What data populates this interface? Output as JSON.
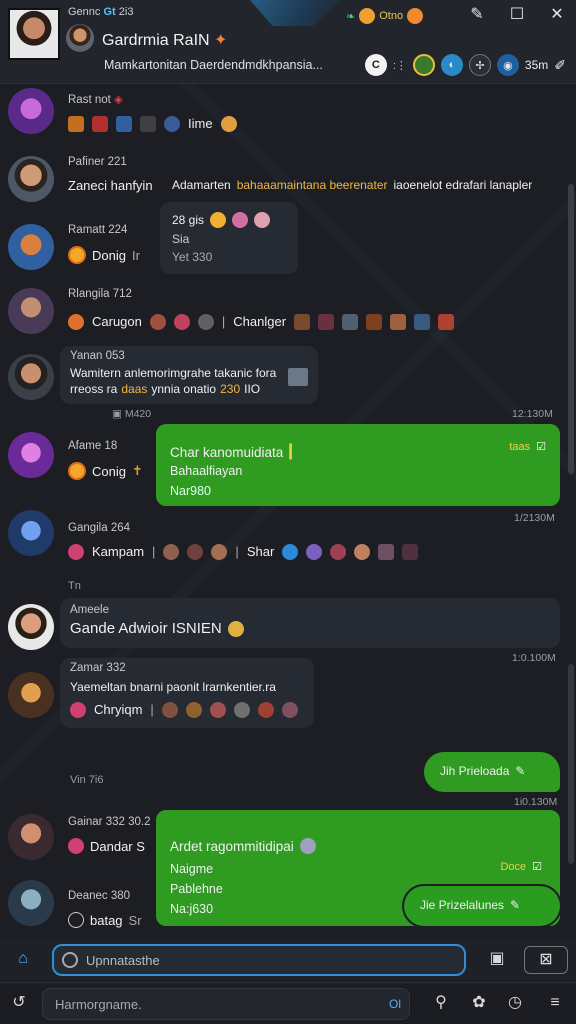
{
  "header": {
    "top_text": "Gennc",
    "top_accent": "Gt",
    "top_extra": "2i3",
    "title": "Gardrmia RaIN",
    "subtitle": "Mamkartonitan Daerdendmdkhpansia...",
    "meta_label": "Otno",
    "count_label": "35m",
    "sub_badge": "C"
  },
  "messages": [
    {
      "name": "Rast not",
      "chips": [
        "Iime"
      ]
    },
    {
      "name": "Pafiner 221",
      "line1": "Zaneci hanfyin",
      "line2": "Adamarten",
      "line2_hl": "bahaaamaintana beerenater",
      "line2_rest": "iaoenelot edrafari lanapler"
    },
    {
      "name": "Ramatt 224",
      "line1": "Donig",
      "suffix": "Ir",
      "bubble_line1": "28 gis",
      "bubble_line2": "Sia",
      "bubble_line3": "Yet 330"
    },
    {
      "name": "Rlangila 712",
      "line1": "Carugon",
      "line2": "Chanlger"
    },
    {
      "name": "Yanan 053",
      "line1": "Wamitern anlemorimgrahe takanic fora",
      "line2a": "rreoss ra",
      "line2_hl": "daas",
      "line2b": "ynnia onatio",
      "line2_hl2": "230",
      "line2c": "IIO",
      "time_left": "M420",
      "time_right": "12:130M"
    },
    {
      "name": "Afame 18",
      "line1": "Conig",
      "green_title": "Char kanomuidiata",
      "green_line2": "Bahaalfiayan",
      "green_line3": "Nar980",
      "green_tag": "taas",
      "time_right": "1/2130M"
    },
    {
      "name": "Gangila 264",
      "line1": "Kampam",
      "line2": "Shar"
    },
    {
      "name": "Ameele",
      "day": "Tn",
      "line1": "Gande Adwioir ISNIEN"
    },
    {
      "name": "Zamar 332",
      "line1": "Yaemeltan bnarni paonit lrarnkentier.ra",
      "line2": "Chryiqm",
      "time_right": "1:0.100M"
    },
    {
      "name": "Vin 7i6",
      "outgoing1": "Jih Prieloada",
      "time_right": "1i0.130M"
    },
    {
      "name": "Gainar 332 30.2",
      "line1": "Dandar S",
      "green_title": "Ardet ragommitidipai",
      "green_line2": "Naigme",
      "green_line3": "Pablehne",
      "green_line4": "Na:j630",
      "green_tag": "Doce"
    },
    {
      "name": "Deanec 380",
      "line1": "batag",
      "suffix": "Sr",
      "outgoing2": "Jie Prizelalunes"
    }
  ],
  "composer": {
    "placeholder": "Upnnatasthe"
  },
  "bottom": {
    "placeholder": "Harmorgname.",
    "hint": "Ol"
  },
  "colors": {
    "accent_green": "#2f9c21",
    "accent_blue": "#2f8fd8",
    "bg": "#1c1e24"
  }
}
